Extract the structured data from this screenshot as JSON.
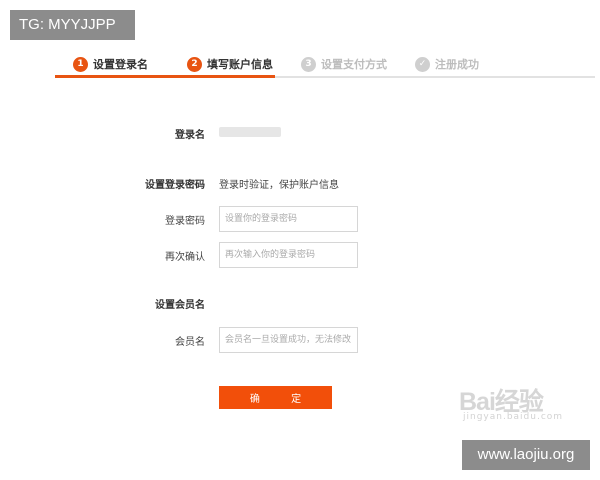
{
  "overlay_tag": "TG: MYYJJPP",
  "steps": [
    {
      "num": "1",
      "label": "设置登录名",
      "state": "active"
    },
    {
      "num": "2",
      "label": "填写账户信息",
      "state": "active"
    },
    {
      "num": "3",
      "label": "设置支付方式",
      "state": "inactive"
    },
    {
      "num": "✓",
      "label": "注册成功",
      "state": "inactive"
    }
  ],
  "form": {
    "login_name_label": "登录名",
    "password_section_label": "设置登录密码",
    "password_section_hint": "登录时验证，保护账户信息",
    "password_label": "登录密码",
    "password_placeholder": "设置你的登录密码",
    "confirm_label": "再次确认",
    "confirm_placeholder": "再次输入你的登录密码",
    "member_section_label": "设置会员名",
    "member_label": "会员名",
    "member_placeholder": "会员名一旦设置成功，无法修改"
  },
  "submit_label": "确 定",
  "watermark": {
    "baidu_text": "Bai经验",
    "baidu_sub": "jingyan.baidu.com",
    "site": "www.laojiu.org"
  },
  "colors": {
    "accent": "#e85412",
    "button": "#f24f0a",
    "inactive": "#cfcfcf"
  }
}
